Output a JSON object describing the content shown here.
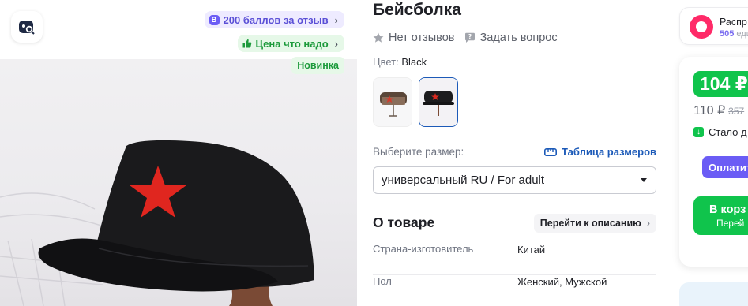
{
  "gallery": {
    "search_icon": "image-search-icon",
    "bonus_pill": {
      "icon": "B",
      "text": "200 баллов за отзыв",
      "chevron": "›"
    },
    "price_pill": {
      "icon": "thumbs-up-icon",
      "text": "Цена что надо",
      "chevron": "›"
    },
    "badge": "Новинка"
  },
  "product": {
    "title": "Бейсболка",
    "reviews": "Нет отзывов",
    "ask": "Задать вопрос",
    "color_label": "Цвет:",
    "color_value": "Black",
    "size_label": "Выберите размер:",
    "size_table": "Таблица размеров",
    "size_selected": "универсальный RU / For adult",
    "about_title": "О товаре",
    "goto_description": "Перейти к описанию",
    "specs": [
      {
        "key": "Страна-изготовитель",
        "value": "Китай"
      },
      {
        "key": "Пол",
        "value": "Женский, Мужской"
      }
    ]
  },
  "seller": {
    "name": "Распр",
    "count": "505",
    "count_suffix": "еди"
  },
  "buybox": {
    "price": "104 ₽",
    "price_old": "110 ₽",
    "price_strike": "357",
    "drop_text": "Стало д",
    "pay_label": "Оплатит",
    "cart_line1": "В корз",
    "cart_line2": "Перей"
  },
  "colors": {
    "accent_green": "#10c44c",
    "accent_purple": "#6b5cf5",
    "link_blue": "#1c5ab8"
  }
}
